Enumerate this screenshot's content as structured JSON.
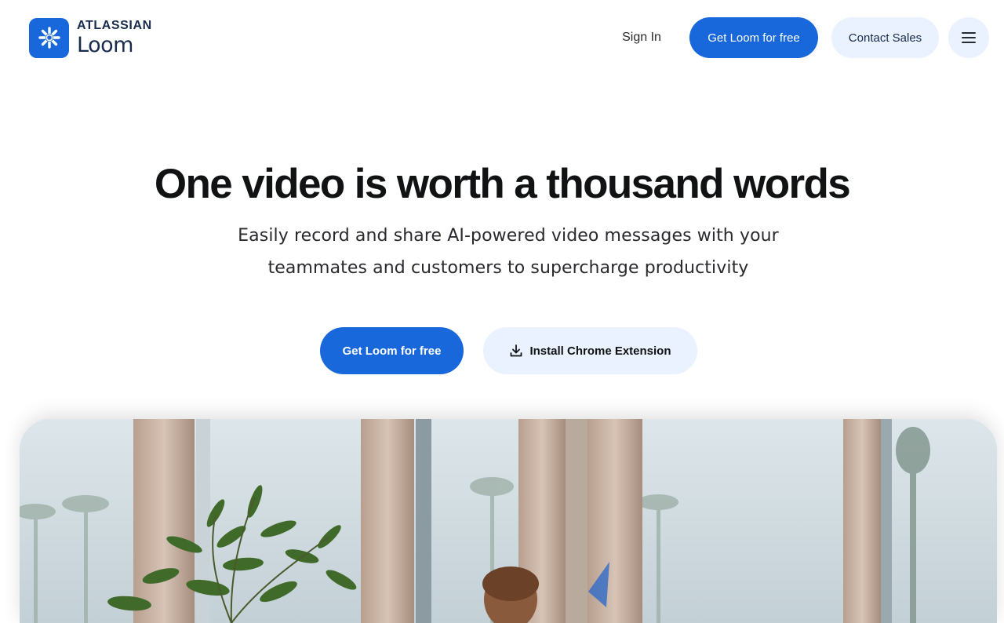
{
  "header": {
    "logo": {
      "brand": "ATLASSIAN",
      "product": "Loom",
      "icon": "loom-logo-icon",
      "color": "#1868db"
    },
    "nav": {
      "sign_in": "Sign In",
      "get_loom": "Get Loom for free",
      "contact_sales": "Contact Sales",
      "menu_icon": "hamburger-menu-icon"
    }
  },
  "hero": {
    "title": "One video is worth a thousand words",
    "subtitle_line1": "Easily record and share AI-powered video messages with your",
    "subtitle_line2": "teammates and customers to supercharge productivity",
    "primary_cta": "Get Loom for free",
    "secondary_cta": "Install Chrome Extension",
    "secondary_cta_icon": "download-icon"
  },
  "colors": {
    "primary": "#1868db",
    "secondary_bg": "#e9f2fe",
    "heading": "#101214",
    "body_text": "#292a2e"
  }
}
